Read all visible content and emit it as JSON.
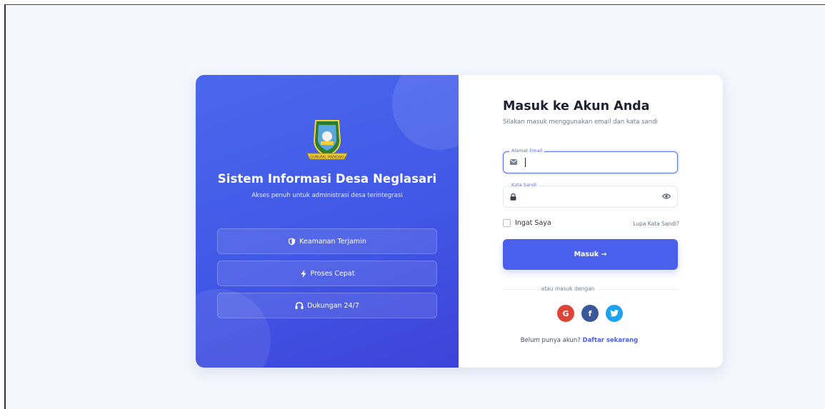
{
  "left_panel": {
    "logo_text": "GUNUNG MANDAKI",
    "title": "Sistem Informasi Desa Neglasari",
    "subtitle": "Akses penuh untuk administrasi desa terintegrasi",
    "features": [
      {
        "label": "Keamanan Terjamin",
        "icon": "shield-icon"
      },
      {
        "label": "Proses Cepat",
        "icon": "bolt-icon"
      },
      {
        "label": "Dukungan 24/7",
        "icon": "headset-icon"
      }
    ]
  },
  "login": {
    "title": "Masuk ke Akun Anda",
    "subtitle": "Silakan masuk menggunakan email dan kata sandi",
    "email_label": "Alamat Email",
    "email_value": "",
    "password_label": "Kata Sandi",
    "password_value": "",
    "remember_label": "Ingat Saya",
    "forgot_label": "Lupa Kata Sandi?",
    "submit_label": "Masuk →",
    "divider_text": "atau masuk dengan",
    "social": [
      {
        "name": "google",
        "glyph": "G",
        "color": "#dd4437"
      },
      {
        "name": "facebook",
        "glyph": "f",
        "color": "#3b5998"
      },
      {
        "name": "twitter",
        "glyph": "t",
        "color": "#1da1f2"
      }
    ],
    "signup_prompt": "Belum punya akun?",
    "signup_link": "Daftar sekarang"
  },
  "colors": {
    "primary": "#4a60ec",
    "page_bg": "#f4f7fd"
  }
}
